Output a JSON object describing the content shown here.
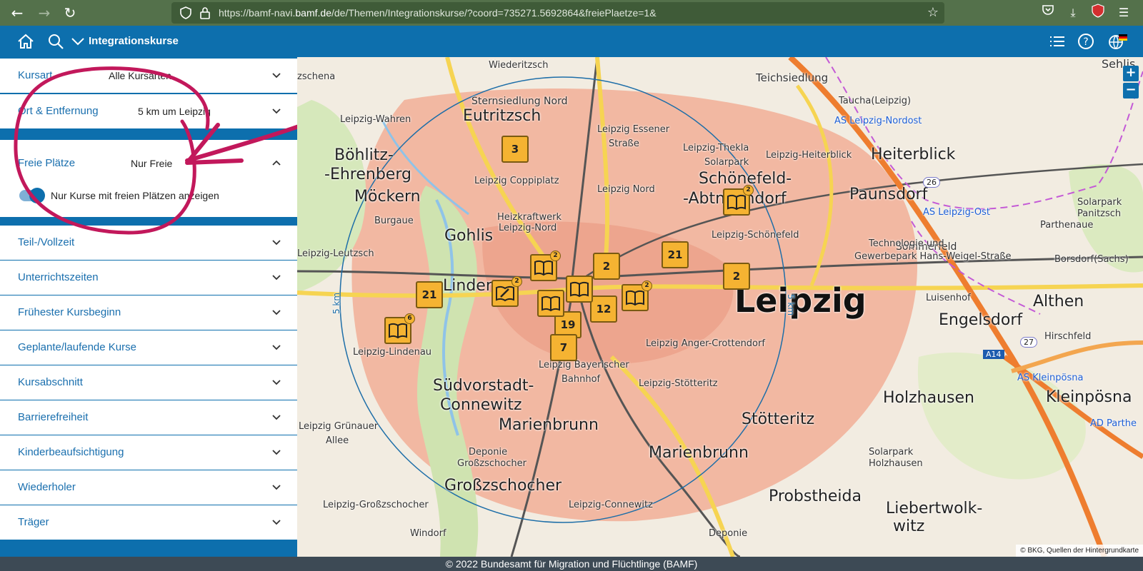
{
  "browser": {
    "url_prefix": "https://bamf-navi.",
    "url_domain": "bamf.de",
    "url_path": "/de/Themen/Integrationskurse/?coord=735271.5692864&freiePlaetze=1&"
  },
  "header": {
    "title": "Integrationskurse"
  },
  "sidebar": {
    "filters": [
      {
        "label": "Kursart",
        "value": "Alle Kursarten"
      },
      {
        "label": "Ort & Entfernung",
        "value": "5 km um Leipzig"
      }
    ],
    "expanded": {
      "label": "Freie Plätze",
      "value": "Nur Freie",
      "toggle_label": "Nur Kurse mit freien Plätzen anzeigen",
      "toggle_on": true
    },
    "collapsed": [
      "Teil-/Vollzeit",
      "Unterrichtszeiten",
      "Frühester Kursbeginn",
      "Geplante/laufende Kurse",
      "Kursabschnitt",
      "Barrierefreiheit",
      "Kinderbeaufsichtigung",
      "Wiederholer",
      "Träger"
    ]
  },
  "map": {
    "places_big": [
      "Eutritzsch",
      "Böhlitz-",
      "-Ehrenberg",
      "Möckern",
      "Gohlis",
      "Linden",
      "Südvorstadt-",
      "Connewitz",
      "Marienbrunn",
      "Großzschocher",
      "Schönefeld-",
      "-Abtnaundorf",
      "Paunsdorf",
      "Heiterblick",
      "Sommerfeld",
      "Engelsdorf",
      "Holzhausen",
      "Stötteritz",
      "Marienbrunn",
      "Probstheida",
      "Liebertwolk-",
      "witz",
      "Althen",
      "Kleinpösna",
      "Teichsiedlung",
      "Borsdorf(Sachs)"
    ],
    "places_medium": [
      "Sternsiedlung Nord",
      "Leipzig-Wahren",
      "Burgaue",
      "Leipzig Coppiplatz",
      "Heizkraftwerk",
      "Leipzig-Nord",
      "Leipzig Essener",
      "Straße",
      "Leipzig Nord",
      "Leipzig-Thekla",
      "Solarpark",
      "Leipzig-Heiterblick",
      "Leipzig-Leutzsch",
      "Leipzig-Lindenau",
      "Leipzig Grünauer",
      "Allee",
      "Leipzig Bayerischer",
      "Bahnhof",
      "Leipzig Anger-Crottendorf",
      "Leipzig-Stötteritz",
      "Deponie",
      "Großzschocher",
      "Leipzig-Connewitz",
      "Leipzig-Großzschocher",
      "Windorf",
      "Technologie und",
      "Gewerbepark Hans-Weigel-Straße",
      "Luisenhof",
      "Hirschfeld",
      "Solarpark",
      "Holzhausen",
      "Taucha(Leipzig)",
      "Parthenaue",
      "Solarpark",
      "Panitzsch",
      "Leipzig-Schönefeld",
      "Wiederitzsch",
      "zschena",
      "Sehlis",
      "Deponie"
    ],
    "city": "Leipzig",
    "radius_label": "5 km",
    "motorway_labels": [
      "AS Leipzig-Nordost",
      "AS Leipzig-Ost",
      "AS Kleinpösna",
      "AD Parthe"
    ],
    "road_numbers": [
      "26",
      "A14",
      "27"
    ],
    "clusters": [
      {
        "label": "3"
      },
      {
        "label": "21"
      },
      {
        "label": "2"
      },
      {
        "label": "2"
      },
      {
        "label": "21"
      },
      {
        "label": "12"
      },
      {
        "label": "19"
      },
      {
        "label": "7"
      }
    ],
    "book_badges": [
      "2",
      "2",
      "2",
      "6",
      "2"
    ],
    "attribution": "© BKG, Quellen der Hintergrundkarte"
  },
  "footer": {
    "text": "© 2022 Bundesamt für Migration und Flüchtlinge (BAMF)"
  },
  "colors": {
    "brand_blue": "#0d6fad",
    "browser_green": "#54714b",
    "cluster_yellow": "#f5b332",
    "annotation_magenta": "#c2185b"
  }
}
